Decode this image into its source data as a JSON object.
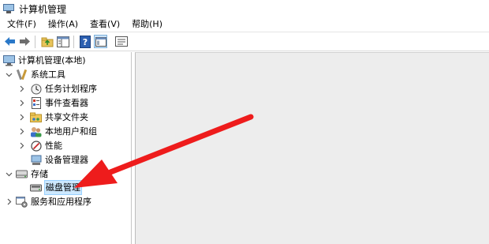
{
  "window": {
    "title": "计算机管理"
  },
  "menu": [
    "文件(F)",
    "操作(A)",
    "查看(V)",
    "帮助(H)"
  ],
  "toolbar": {
    "buttons": [
      "back-icon",
      "forward-icon",
      "up-folder-icon",
      "show-tree-icon",
      "help-icon",
      "view-icon",
      "properties-icon"
    ]
  },
  "tree": {
    "root": "计算机管理(本地)",
    "system_tools": "系统工具",
    "task_scheduler": "任务计划程序",
    "event_viewer": "事件查看器",
    "shared_folders": "共享文件夹",
    "local_users": "本地用户和组",
    "performance": "性能",
    "device_manager": "设备管理器",
    "storage": "存储",
    "disk_management": "磁盘管理",
    "services_apps": "服务和应用程序"
  },
  "annotation": {
    "type": "red-arrow",
    "color": "#ee1c1c",
    "points_to": "磁盘管理"
  }
}
